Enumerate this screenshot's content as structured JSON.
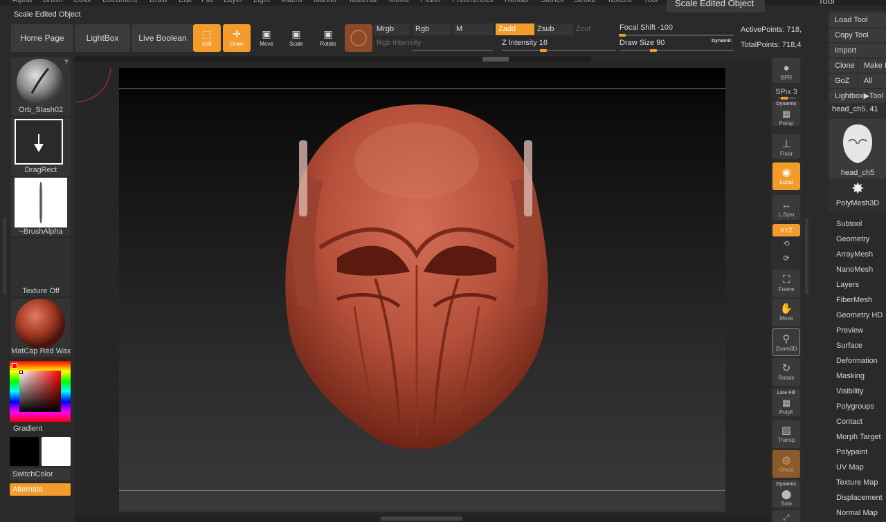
{
  "menu": {
    "items": [
      "Alpha",
      "Brush",
      "Color",
      "Document",
      "Draw",
      "Edit",
      "File",
      "Layer",
      "Light",
      "Macro",
      "Marker",
      "Material",
      "Movie",
      "Picker",
      "Preferences",
      "Render",
      "Stencil",
      "Stroke",
      "Texture",
      "Tool"
    ],
    "popup_title": "Scale Edited Object",
    "right_title": "Tool"
  },
  "title_label": "Scale Edited Object",
  "shelf": {
    "home_page": "Home Page",
    "lightbox": "LightBox",
    "live_boolean": "Live Boolean",
    "tools": [
      {
        "label": "Edit",
        "icon": "edit-icon",
        "active": true
      },
      {
        "label": "Draw",
        "icon": "draw-icon",
        "active": true
      },
      {
        "label": "Move",
        "icon": "move-icon",
        "active": false
      },
      {
        "label": "Scale",
        "icon": "scale-icon",
        "active": false
      },
      {
        "label": "Rotate",
        "icon": "rotate-icon",
        "active": false
      }
    ],
    "mrgb": "Mrgb",
    "rgb": "Rgb",
    "m": "M",
    "rgb_intensity": "Rgb Intensity",
    "zadd": "Zadd",
    "zsub": "Zsub",
    "zcut": "Zcut",
    "z_intensity": "Z Intensity 16",
    "focal_shift": "Focal Shift -100",
    "draw_size": "Draw Size 90",
    "dynamic": "Dynamic",
    "active_points": "ActivePoints: 718,",
    "total_points": "TotalPoints: 718,4"
  },
  "left_tray": {
    "brush": "Orb_Slash02",
    "stroke": "DragRect",
    "alpha": "~BrushAlpha",
    "texture": "Texture Off",
    "material": "MatCap Red Wax",
    "gradient": "Gradient",
    "switch_color": "SwitchColor",
    "alternate": "Alternate",
    "help_mark": "?"
  },
  "right_shelf": {
    "bpr": "BPR",
    "spix": "SPix 3",
    "dynamic": "Dynamic",
    "persp": "Persp",
    "floor": "Floor",
    "local": "Local",
    "lsym": "L.Sym",
    "xyz": "XYZ",
    "frame": "Frame",
    "move": "Move",
    "zoom3d": "Zoom3D",
    "rotate": "Rotate",
    "line_fill": "Line Fill",
    "polyf": "PolyF",
    "transp": "Transp",
    "ghost": "Ghost",
    "dynamic2": "Dynamic",
    "solo": "Solo"
  },
  "tool_panel": {
    "load_tool": "Load Tool",
    "copy_tool": "Copy Tool",
    "import": "Import",
    "clone": "Clone",
    "make": "Make I",
    "goz": "GoZ",
    "all": "All",
    "lightbox_tool": "Lightbox▶Tool",
    "current_tool": "head_ch5. 41",
    "thumb_label": "head_ch5",
    "polymesh_label": "PolyMesh3D",
    "subpalettes": [
      "Subtool",
      "Geometry",
      "ArrayMesh",
      "NanoMesh",
      "Layers",
      "FiberMesh",
      "Geometry HD",
      "Preview",
      "Surface",
      "Deformation",
      "Masking",
      "Visibility",
      "Polygroups",
      "Contact",
      "Morph Target",
      "Polypaint",
      "UV Map",
      "Texture Map",
      "Displacement",
      "Normal Map"
    ]
  },
  "colors": {
    "accent": "#f39c2c",
    "clay": "#b5503a",
    "panel": "#2d2d2d"
  }
}
